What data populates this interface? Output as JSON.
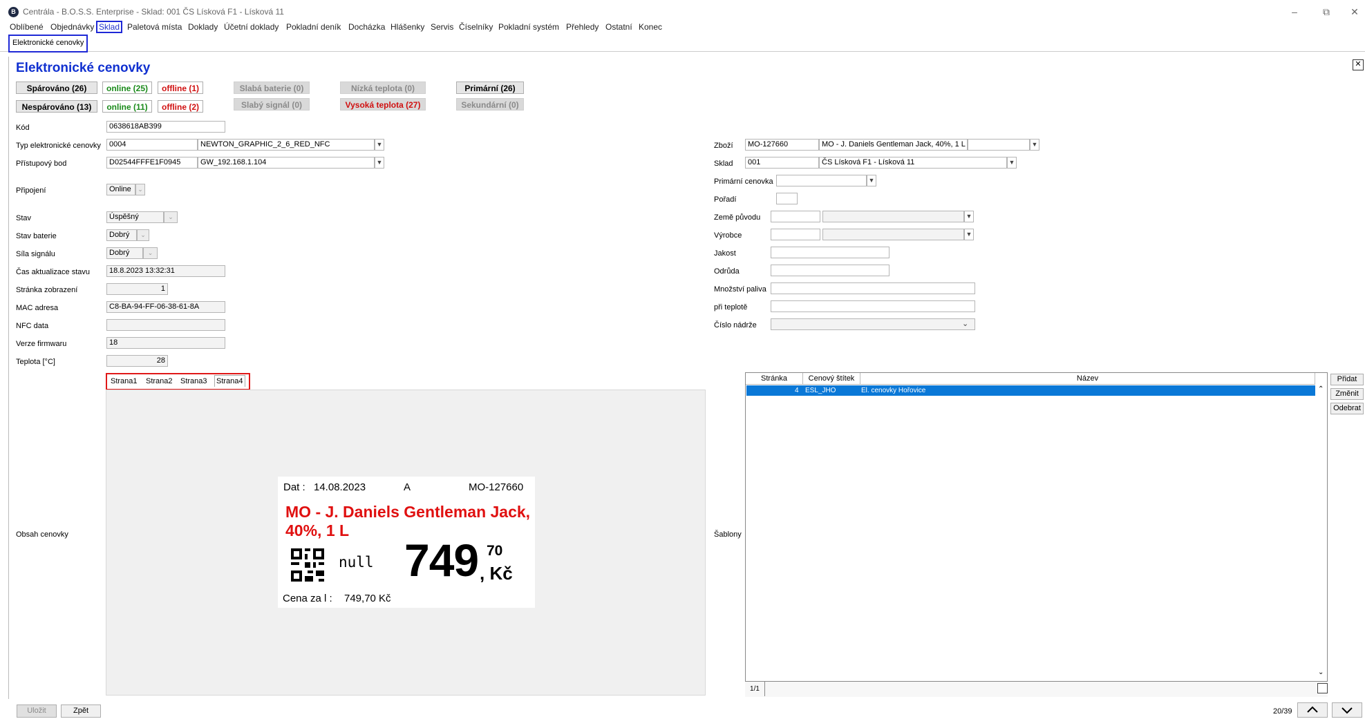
{
  "window": {
    "title": "Centrála - B.O.S.S. Enterprise - Sklad: 001 ČS Lísková F1 - Lísková 11",
    "logo": "B"
  },
  "menu": [
    "Oblíbené",
    "Objednávky",
    "Sklad",
    "Paletová místa",
    "Doklady",
    "Účetní doklady",
    "Pokladní deník",
    "Docházka",
    "Hlášenky",
    "Servis",
    "Číselníky",
    "Pokladní systém",
    "Přehledy",
    "Ostatní",
    "Konec"
  ],
  "tab": {
    "label": "Elektronické cenovky"
  },
  "page": {
    "title": "Elektronické cenovky"
  },
  "status": {
    "sparovano": "Spárováno (26)",
    "sparovano_online": "online (25)",
    "sparovano_offline": "offline (1)",
    "nesparovano": "Nespárováno (13)",
    "nesparovano_online": "online (11)",
    "nesparovano_offline": "offline (2)",
    "slaba_baterie": "Slabá baterie (0)",
    "slaby_signal": "Slabý signál (0)",
    "nizka_teplota": "Nízká teplota (0)",
    "vysoka_teplota": "Vysoká teplota (27)",
    "primarni": "Primární (26)",
    "sekundarni": "Sekundární (0)"
  },
  "form_left": {
    "kod": {
      "label": "Kód",
      "value": "0638618AB399"
    },
    "typ": {
      "label": "Typ elektronické cenovky",
      "code": "0004",
      "name": "NEWTON_GRAPHIC_2_6_RED_NFC"
    },
    "pristupovy_bod": {
      "label": "Přístupový bod",
      "code": "D02544FFFE1F0945",
      "name": "GW_192.168.1.104"
    },
    "pripojeni": {
      "label": "Připojení",
      "value": "Online"
    },
    "stav": {
      "label": "Stav",
      "value": "Úspěšný"
    },
    "stav_baterie": {
      "label": "Stav baterie",
      "value": "Dobrý"
    },
    "sila_signalu": {
      "label": "Síla signálu",
      "value": "Dobrý"
    },
    "cas_aktualizace": {
      "label": "Čas aktualizace stavu",
      "value": "18.8.2023 13:32:31"
    },
    "stranka_zobrazeni": {
      "label": "Stránka zobrazení",
      "value": "1"
    },
    "mac": {
      "label": "MAC adresa",
      "value": "C8-BA-94-FF-06-38-61-8A"
    },
    "nfc": {
      "label": "NFC data",
      "value": ""
    },
    "firmware": {
      "label": "Verze firmwaru",
      "value": "18"
    },
    "teplota": {
      "label": "Teplota [°C]",
      "value": "28"
    },
    "obsah": {
      "label": "Obsah cenovky"
    }
  },
  "page_tabs": [
    "Strana1",
    "Strana2",
    "Strana3",
    "Strana4"
  ],
  "price_tag": {
    "date_label": "Dat :",
    "date": "14.08.2023",
    "flag": "A",
    "code": "MO-127660",
    "name": "MO - J. Daniels Gentleman Jack, 40%, 1 L",
    "null_text": "null",
    "price": "749",
    "cents": "70",
    "currency": ", Kč",
    "unit_label": "Cena za  l :",
    "unit_price": "749,70 Kč"
  },
  "form_right": {
    "zbozi": {
      "label": "Zboží",
      "code": "MO-127660",
      "name": "MO - J. Daniels Gentleman Jack, 40%, 1 L"
    },
    "sklad": {
      "label": "Sklad",
      "code": "001",
      "name": "ČS Lísková F1 - Lísková 11"
    },
    "primarni_cenovka": {
      "label": "Primární cenovka"
    },
    "poradi": {
      "label": "Pořadí"
    },
    "zeme_puvodu": {
      "label": "Země původu"
    },
    "vyrobce": {
      "label": "Výrobce"
    },
    "jakost": {
      "label": "Jakost"
    },
    "odruda": {
      "label": "Odrůda"
    },
    "mnozstvi_paliva": {
      "label": "Množství paliva"
    },
    "pri_teplote": {
      "label": "při teplotě"
    },
    "cislo_nadrze": {
      "label": "Číslo nádrže"
    },
    "sablony": {
      "label": "Šablony"
    }
  },
  "grid": {
    "headers": [
      "Stránka",
      "Cenový štítek",
      "Název"
    ],
    "rows": [
      {
        "stranka": "4",
        "stitek": "ESL_JHO",
        "nazev": "El. cenovky Hořovice"
      }
    ],
    "pager": "1/1"
  },
  "grid_buttons": {
    "pridat": "Přidat",
    "zmenit": "Změnit",
    "odebrat": "Odebrat"
  },
  "bottom": {
    "ulozit": "Uložit",
    "zpet": "Zpět",
    "record": "20/39"
  }
}
